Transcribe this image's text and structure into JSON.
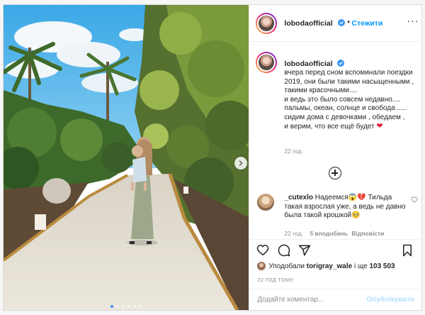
{
  "post": {
    "username": "lobodaofficial",
    "follow_label": "Стежити",
    "separator": "•",
    "more_label": "···",
    "caption": "вчера перед сном вспоминали поездки 2019, они были такими насыщенными , такими красочными....\nи ведь это было совсем недавно....\nпальмы, океан, солнце и свобода .....\nсидим дома с девочками , обедаем ,\nи верим, что все ещё будет",
    "caption_emoji": "❤",
    "caption_time": "22 год.",
    "comment": {
      "username": "_cutexlo",
      "text": "Надеемся😱💔 Тильда такая взрослая уже, а ведь не давно была такой крошкой🥺",
      "time": "22 год.",
      "likes": "5 вподобань",
      "reply": "Відповісти"
    },
    "likes": {
      "prefix": "Уподобали",
      "user": "torigray_wale",
      "middle": "і ще",
      "count": "103 503"
    },
    "post_time": "22 ГОД ТОМУ",
    "comment_placeholder": "Додайте коментар...",
    "publish_label": "Опублікувати"
  },
  "colors": {
    "link_blue": "#0095f6",
    "verified_blue": "#3897f0",
    "muted": "#8e8e8e",
    "publish_disabled": "#b2dffc"
  },
  "carousel": {
    "current": 1,
    "total": 6
  }
}
